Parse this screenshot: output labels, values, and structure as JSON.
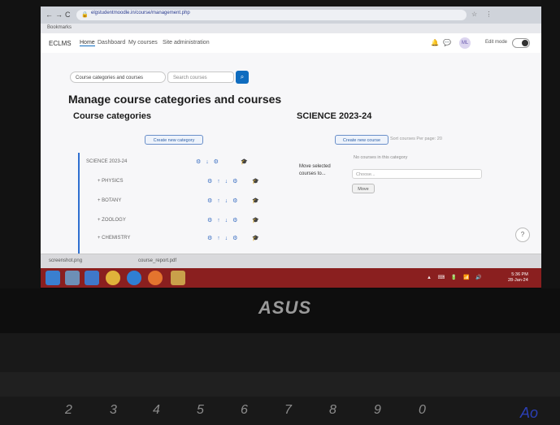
{
  "browser": {
    "url": "elgstudentmoodle.in/course/management.php",
    "bookmark": "Bookmarks",
    "nav_back": "←",
    "nav_forward": "→",
    "nav_reload": "C",
    "ext_icons": "☆ ⋮"
  },
  "site": {
    "brand": "ECLMS",
    "nav": [
      "Home",
      "Dashboard",
      "My courses",
      "Site administration"
    ],
    "active_nav_index": 0,
    "notification_icon": "bell-icon",
    "message_icon": "chat-icon",
    "user_initials": "ML",
    "edit_mode_label": "Edit mode"
  },
  "toolbar": {
    "category_select": "Course categories and courses",
    "search_placeholder": "Search courses",
    "search_icon": "⌕"
  },
  "page": {
    "title": "Manage course categories and courses",
    "left_section": "Course categories",
    "right_section": "SCIENCE 2023-24",
    "create_category_btn": "Create new category",
    "create_course_btn": "Create new course",
    "right_hint": "Sort courses  Per page: 20"
  },
  "categories": [
    {
      "label": "SCIENCE 2023-24",
      "actions": "⚙ ↓ ⚙",
      "hat": "🎓"
    },
    {
      "label": "+ PHYSICS",
      "actions": "⚙ ↑ ↓ ⚙",
      "hat": "🎓"
    },
    {
      "label": "+ BOTANY",
      "actions": "⚙ ↑ ↓ ⚙",
      "hat": "🎓"
    },
    {
      "label": "+ ZOOLOGY",
      "actions": "⚙ ↑ ↓ ⚙",
      "hat": "🎓"
    },
    {
      "label": "+ CHEMISTRY",
      "actions": "⚙ ↑ ↓ ⚙",
      "hat": "🎓"
    }
  ],
  "move": {
    "text": "Move selected courses to...",
    "label": "No courses in this category",
    "select_value": "Choose...",
    "button": "Move"
  },
  "help_icon": "?",
  "downloads": [
    "screenshot.png",
    "course_report.pdf"
  ],
  "tray": {
    "time": "5:36 PM",
    "date": "28-Jan-24"
  },
  "device": {
    "brand": "ASUS",
    "digits": [
      "2",
      "3",
      "4",
      "5",
      "6",
      "7",
      "8",
      "9",
      "0"
    ]
  },
  "ink": "Ao"
}
